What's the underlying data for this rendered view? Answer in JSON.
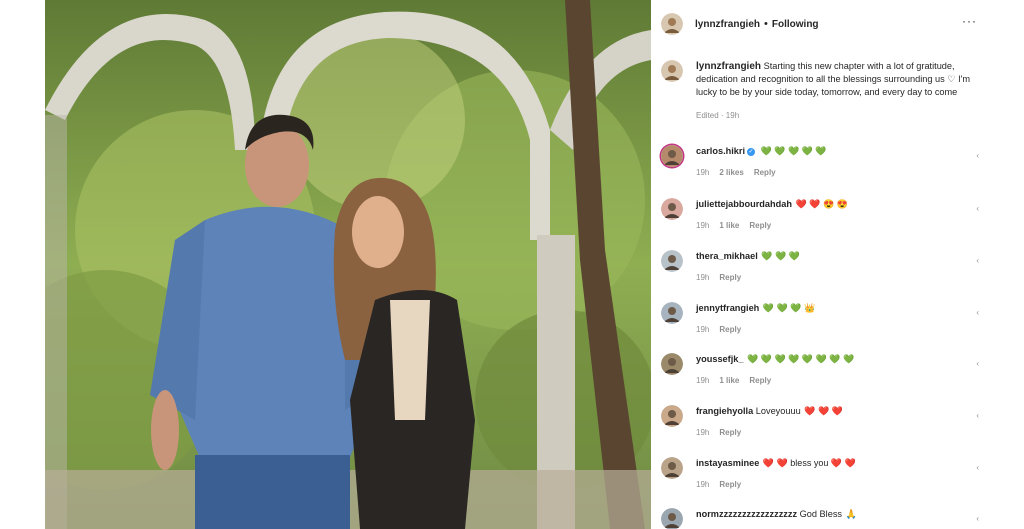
{
  "post": {
    "username": "lynnzfrangieh",
    "separator": "•",
    "follow_status": "Following",
    "more_icon": "more-icon",
    "caption_user": "lynnzfrangieh",
    "caption_text": "Starting this new chapter with a lot of gratitude, dedication and recognition to all the blessings surrounding us ♡ I'm lucky to be by your side today, tomorrow, and every day to come",
    "caption_meta": "Edited · 19h"
  },
  "comments": [
    {
      "user": "carlos.hikri",
      "verified": true,
      "text": "",
      "emoji": "💚 💚 💚 💚 💚",
      "time": "19h",
      "likes": "2 likes",
      "reply": "Reply"
    },
    {
      "user": "juliettejabbourdahdah",
      "verified": false,
      "text": "",
      "emoji": "❤️ ❤️ 😍 😍",
      "time": "19h",
      "likes": "1 like",
      "reply": "Reply"
    },
    {
      "user": "thera_mikhael",
      "verified": false,
      "text": "",
      "emoji": "💚 💚 💚",
      "time": "19h",
      "likes": "",
      "reply": "Reply"
    },
    {
      "user": "jennytfrangieh",
      "verified": false,
      "text": "",
      "emoji": "💚 💚 💚 👑",
      "time": "19h",
      "likes": "",
      "reply": "Reply"
    },
    {
      "user": "youssefjk_",
      "verified": false,
      "text": "",
      "emoji": "💚 💚 💚 💚 💚 💚 💚 💚",
      "time": "19h",
      "likes": "1 like",
      "reply": "Reply"
    },
    {
      "user": "frangiehyolla",
      "verified": false,
      "text": "Loveyouuu",
      "emoji": "❤️ ❤️ ❤️",
      "time": "19h",
      "likes": "",
      "reply": "Reply"
    },
    {
      "user": "instayasminee",
      "verified": false,
      "text": "",
      "emoji": "❤️ ❤️ bless you ❤️ ❤️",
      "time": "19h",
      "likes": "",
      "reply": "Reply"
    },
    {
      "user": "normzzzzzzzzzzzzzzzzz",
      "verified": false,
      "text": "God Bless",
      "emoji": "🙏",
      "time": "",
      "likes": "",
      "reply": ""
    }
  ],
  "icons": {
    "heart": "heart-outline-icon",
    "verified": "verified-badge-icon"
  }
}
